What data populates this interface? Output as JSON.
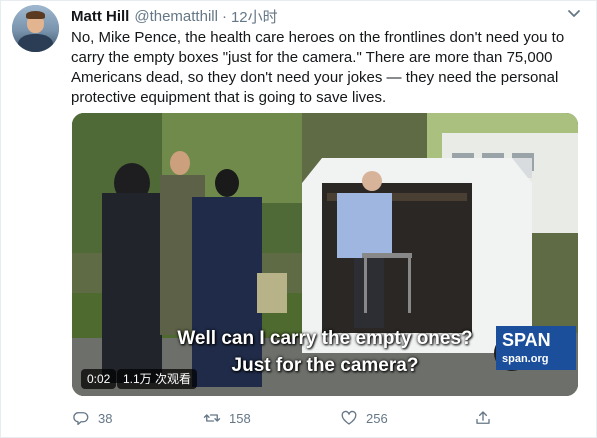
{
  "author": {
    "name": "Matt Hill",
    "handle": "@thematthill",
    "separator": "·",
    "time": "12小时"
  },
  "tweet": {
    "text": "No, Mike Pence, the health care heroes on the frontlines don't need you to carry the empty boxes \"just for the camera.\" There are more than 75,000 Americans dead, so they don't need your jokes — they need the personal protective equipment that is going to save lives."
  },
  "video": {
    "subtitle_line1": "Well can I carry the empty ones?",
    "subtitle_line2": "Just for the camera?",
    "watermark_line1": "SPAN",
    "watermark_line2": "span.org",
    "duration": "0:02",
    "views": "1.1万 次观看"
  },
  "actions": {
    "replies": "38",
    "retweets": "158",
    "likes": "256"
  },
  "colors": {
    "text": "#14171a",
    "muted": "#657786",
    "border": "#e6ecf0",
    "cspan_blue": "#1b4f9c"
  },
  "icons": [
    "reply-icon",
    "retweet-icon",
    "like-icon",
    "share-icon",
    "caret-down-icon",
    "avatar"
  ]
}
